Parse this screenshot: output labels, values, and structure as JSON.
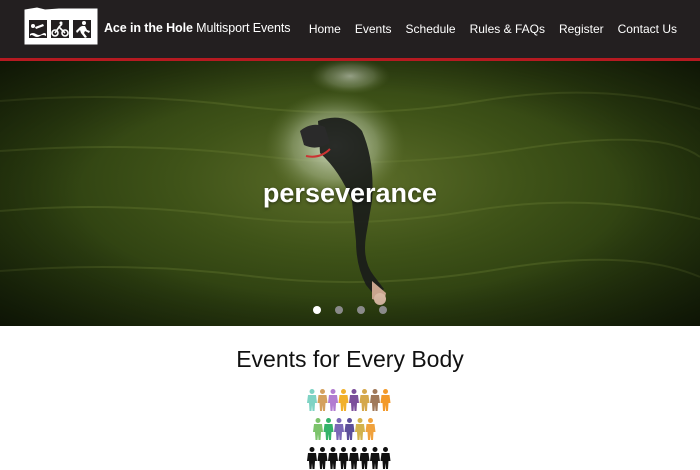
{
  "brand": {
    "strong": "Ace in the Hole",
    "rest": " Multisport Events"
  },
  "nav": [
    {
      "label": "Home"
    },
    {
      "label": "Events"
    },
    {
      "label": "Schedule"
    },
    {
      "label": "Rules & FAQs"
    },
    {
      "label": "Register"
    },
    {
      "label": "Contact Us"
    }
  ],
  "hero": {
    "title": "perseverance",
    "slide_count": 4,
    "active_slide": 1
  },
  "section": {
    "title": "Events for Every Body"
  },
  "colors": {
    "header_bg": "#231f20",
    "header_rule": "#b61a21",
    "people_row1": [
      "#7fd3c4",
      "#d4a15d",
      "#b27cd0",
      "#f1b12b",
      "#7c4f9b",
      "#d5a84b",
      "#a0795a",
      "#f39a2a"
    ],
    "people_row2": [
      "#7cc36b",
      "#34b369",
      "#7a68b6",
      "#5d4f9a",
      "#d2b24c",
      "#f0a23d"
    ],
    "people_row3": [
      "#111111",
      "#111111",
      "#111111",
      "#111111",
      "#111111",
      "#111111",
      "#111111",
      "#111111"
    ]
  },
  "icons": [
    "triathlon-logo-icon",
    "swimmer-icon",
    "cyclist-icon",
    "runner-icon",
    "people-icon"
  ]
}
